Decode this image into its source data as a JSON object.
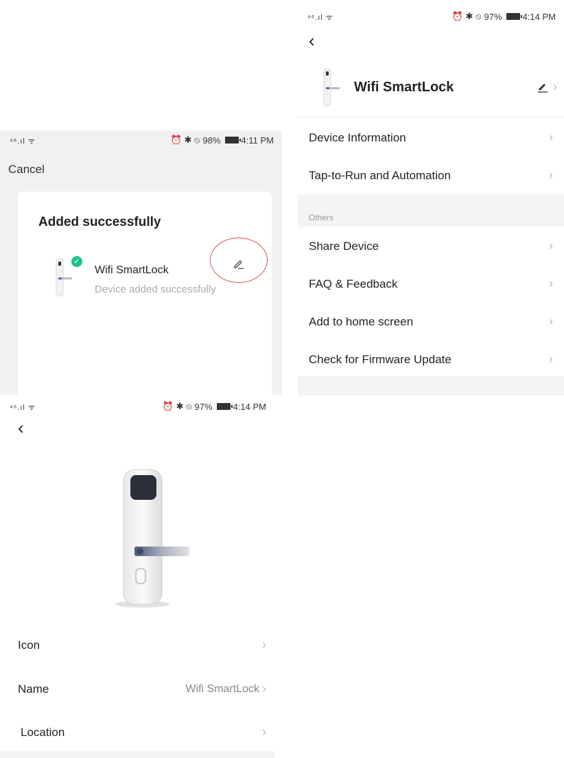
{
  "panel_added": {
    "status": {
      "network": "⁴⁶.ıl ᯤ",
      "icons": "⏰ ✱ ⦸",
      "battery": "98%",
      "time": "4:11 PM"
    },
    "cancel_label": "Cancel",
    "card_title": "Added successfully",
    "device_name": "Wifi SmartLock",
    "device_status": "Device added successfully"
  },
  "panel_settings": {
    "status": {
      "network": "⁴⁶.ıl ᯤ",
      "icons": "⏰ ✱ ⦸",
      "battery": "97%",
      "time": "4:14 PM"
    },
    "device_name": "Wifi SmartLock",
    "rows": [
      {
        "label": "Device Information"
      },
      {
        "label": "Tap-to-Run and Automation"
      }
    ],
    "section_label": "Others",
    "other_rows": [
      {
        "label": "Share Device"
      },
      {
        "label": "FAQ & Feedback"
      },
      {
        "label": "Add to home screen"
      },
      {
        "label": "Check for Firmware Update"
      }
    ]
  },
  "panel_edit": {
    "status": {
      "network": "⁴⁶.ıl ᯤ",
      "icons": "⏰ ✱ ⦸",
      "battery": "97%",
      "time": "4:14 PM"
    },
    "rows": [
      {
        "label": "Icon",
        "value": ""
      },
      {
        "label": "Name",
        "value": "Wifi SmartLock"
      },
      {
        "label": "Location",
        "value": ""
      }
    ]
  },
  "colors": {
    "accent_check": "#1fc28e",
    "highlight_circle": "#e05050",
    "separator_bg": "#f4f4f4"
  }
}
